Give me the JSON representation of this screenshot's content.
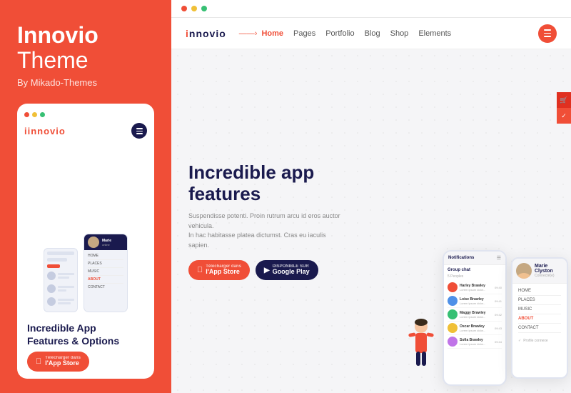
{
  "left_panel": {
    "title": "Innovio",
    "subtitle": "Theme",
    "by_line": "By Mikado-Themes",
    "card": {
      "logo": "innovio",
      "logo_dot": "i",
      "tagline": "Incredible App\nFeatures & Options",
      "appstore_btn": {
        "small_label": "Télécharger dans",
        "main_label": "l'App Store"
      }
    },
    "dots": [
      "red",
      "yellow",
      "green"
    ]
  },
  "right_panel": {
    "browser_dots": [
      "red",
      "yellow",
      "green"
    ],
    "nav": {
      "logo": "innovio",
      "logo_dot": "i",
      "home": "Home",
      "links": [
        "Pages",
        "Portfolio",
        "Blog",
        "Shop",
        "Elements"
      ]
    },
    "hero": {
      "title_line1": "Incredible app",
      "title_line2": "features",
      "description": "Suspendisse potenti. Proin rutrum arcu id eros auctor vehicula.\nIn hac habitasse platea dictumst. Cras eu iaculis sapien.",
      "btn_appstore": {
        "small": "Télécharger dans",
        "main": "l'App Store"
      },
      "btn_google": {
        "small": "DISPONIBLE SUR",
        "main": "Google Play"
      }
    },
    "phone_main": {
      "header": "Notifications",
      "group": "Group chat",
      "count": "5 Peoples",
      "chats": [
        {
          "name": "Harley Brawley",
          "msg": "Lorem ipsum dolor...",
          "time": "09:40",
          "color": "#F04E37"
        },
        {
          "name": "Loise Brawley",
          "msg": "Lorem ipsum dolor...",
          "time": "09:41",
          "color": "#4e90e8"
        },
        {
          "name": "Maggy Brawley",
          "msg": "Lorem ipsum dolor...",
          "time": "09:42",
          "color": "#37c074"
        },
        {
          "name": "Oscar Brawley",
          "msg": "Lorem ipsum dolor...",
          "time": "09:43",
          "color": "#f0c037"
        },
        {
          "name": "Sofia Brawley",
          "msg": "Lorem ipsum dolor...",
          "time": "09:44",
          "color": "#c074e8"
        }
      ]
    },
    "phone_right": {
      "name": "Marie Clyston",
      "handle": "Connecté(e)",
      "menu_items": [
        "HOME",
        "PLACES",
        "MUSIC",
        "ABOUT",
        "CONTACT"
      ],
      "active_item": "ABOUT",
      "footer": "Profile connexe"
    }
  }
}
